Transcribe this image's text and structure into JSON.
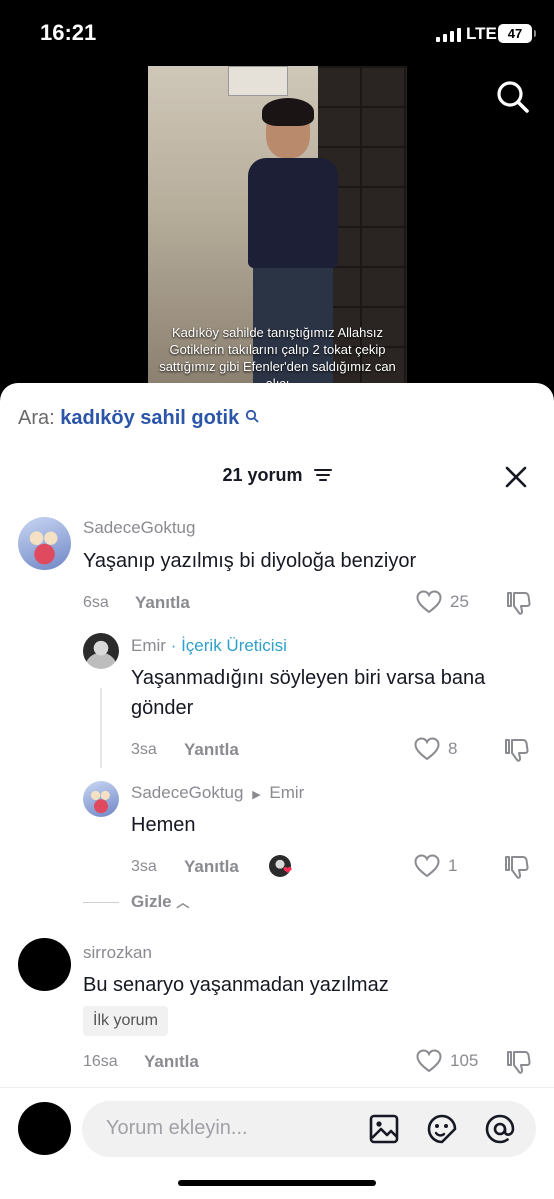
{
  "status_bar": {
    "time": "16:21",
    "network": "LTE",
    "battery": "47"
  },
  "video": {
    "caption": "Kadıköy sahilde tanıştığımız Allahsız Gotiklerin takılarını çalıp 2 tokat çekip sattığımız gibi Efenler'den saldığımız can alıcı"
  },
  "sheet": {
    "search_label": "Ara:",
    "search_query": "kadıköy sahil gotik",
    "comment_count": "21 yorum"
  },
  "comments": [
    {
      "username": "SadeceGoktug",
      "text": "Yaşanıp yazılmış bi diyoloğa benziyor",
      "time": "6sa",
      "reply_label": "Yanıtla",
      "likes": "25"
    },
    {
      "username": "Emir",
      "badge": "· İçerik Üreticisi",
      "text": "Yaşanmadığını söyleyen biri varsa bana gönder",
      "time": "3sa",
      "reply_label": "Yanıtla",
      "likes": "8"
    },
    {
      "username": "SadeceGoktug",
      "reply_to": "Emir",
      "text": "Hemen",
      "time": "3sa",
      "reply_label": "Yanıtla",
      "likes": "1"
    },
    {
      "username": "sirrozkan",
      "text": "Bu senaryo yaşanmadan yazılmaz",
      "badge": "İlk yorum",
      "time": "16sa",
      "reply_label": "Yanıtla",
      "likes": "105"
    }
  ],
  "hide_replies": "Gizle",
  "composer": {
    "placeholder": "Yorum ekleyin..."
  }
}
